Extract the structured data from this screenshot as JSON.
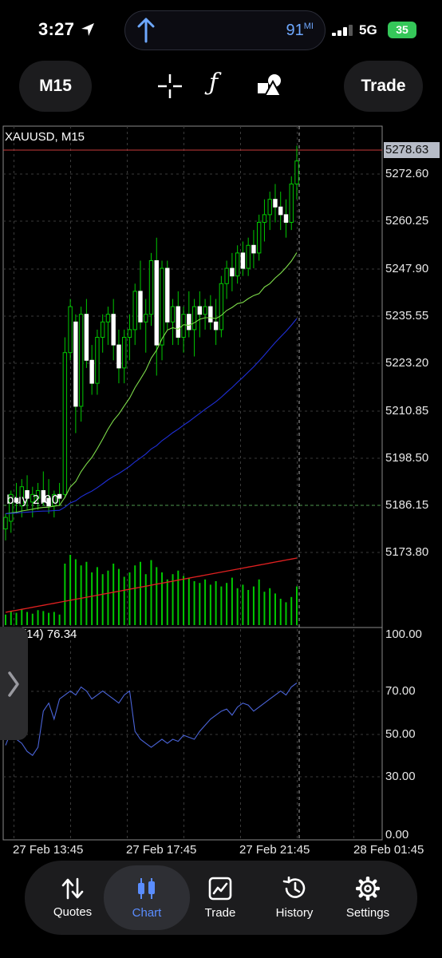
{
  "status_bar": {
    "time": "3:27",
    "island_distance": "91",
    "island_unit": "MI",
    "network": "5G",
    "battery": "35"
  },
  "toolbar": {
    "timeframe": "M15",
    "trade": "Trade",
    "icons": [
      "crosshair-icon",
      "function-icon",
      "objects-icon"
    ]
  },
  "chart": {
    "symbol": "XAUUSD, M15",
    "current_price": "5278.63",
    "price_labels": [
      "5272.60",
      "5260.25",
      "5247.90",
      "5235.55",
      "5223.20",
      "5210.85",
      "5198.50",
      "5186.15",
      "5173.80"
    ],
    "position_label": "buy 2.00",
    "rsi_label": "(14) 76.34",
    "rsi_levels": [
      "100.00",
      "70.00",
      "50.00",
      "30.00",
      "0.00"
    ],
    "time_labels": [
      "27 Feb 13:45",
      "27 Feb 17:45",
      "27 Feb 21:45",
      "28 Feb 01:45"
    ],
    "colors": {
      "candle_up": "#00c800",
      "candle_down": "#ffffff",
      "ma_fast": "#7ddc4a",
      "ma_slow": "#1f2fd8",
      "volume_ma": "#e02020",
      "rsi": "#4a64d8",
      "price_line": "#c83a3a"
    }
  },
  "bottom_nav": {
    "items": [
      {
        "label": "Quotes",
        "icon": "quotes-icon"
      },
      {
        "label": "Chart",
        "icon": "chart-icon"
      },
      {
        "label": "Trade",
        "icon": "trade-icon"
      },
      {
        "label": "History",
        "icon": "history-icon"
      },
      {
        "label": "Settings",
        "icon": "settings-icon"
      }
    ],
    "active": "Chart"
  }
}
